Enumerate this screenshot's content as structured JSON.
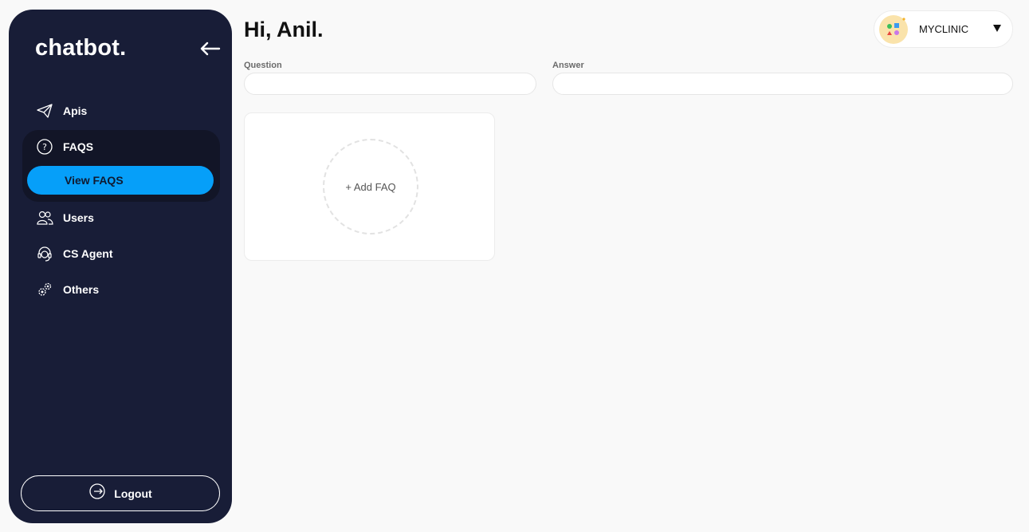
{
  "sidebar": {
    "brand": "chatbot.",
    "items": [
      {
        "label": "Apis",
        "icon": "paper-plane-icon"
      },
      {
        "label": "FAQS",
        "icon": "question-circle-icon"
      },
      {
        "label": "Users",
        "icon": "users-icon"
      },
      {
        "label": "CS Agent",
        "icon": "headset-icon"
      },
      {
        "label": "Others",
        "icon": "gears-icon"
      }
    ],
    "active_subitem": "View FAQS",
    "logout_label": "Logout"
  },
  "header": {
    "greeting": "Hi, Anil.",
    "org_name": "MYCLINIC"
  },
  "form": {
    "question_label": "Question",
    "question_value": "",
    "answer_label": "Answer",
    "answer_value": ""
  },
  "card": {
    "add_label": "+ Add FAQ"
  },
  "colors": {
    "sidebar_bg": "#181d37",
    "accent": "#069ff9",
    "page_bg": "#f9f9f9"
  }
}
